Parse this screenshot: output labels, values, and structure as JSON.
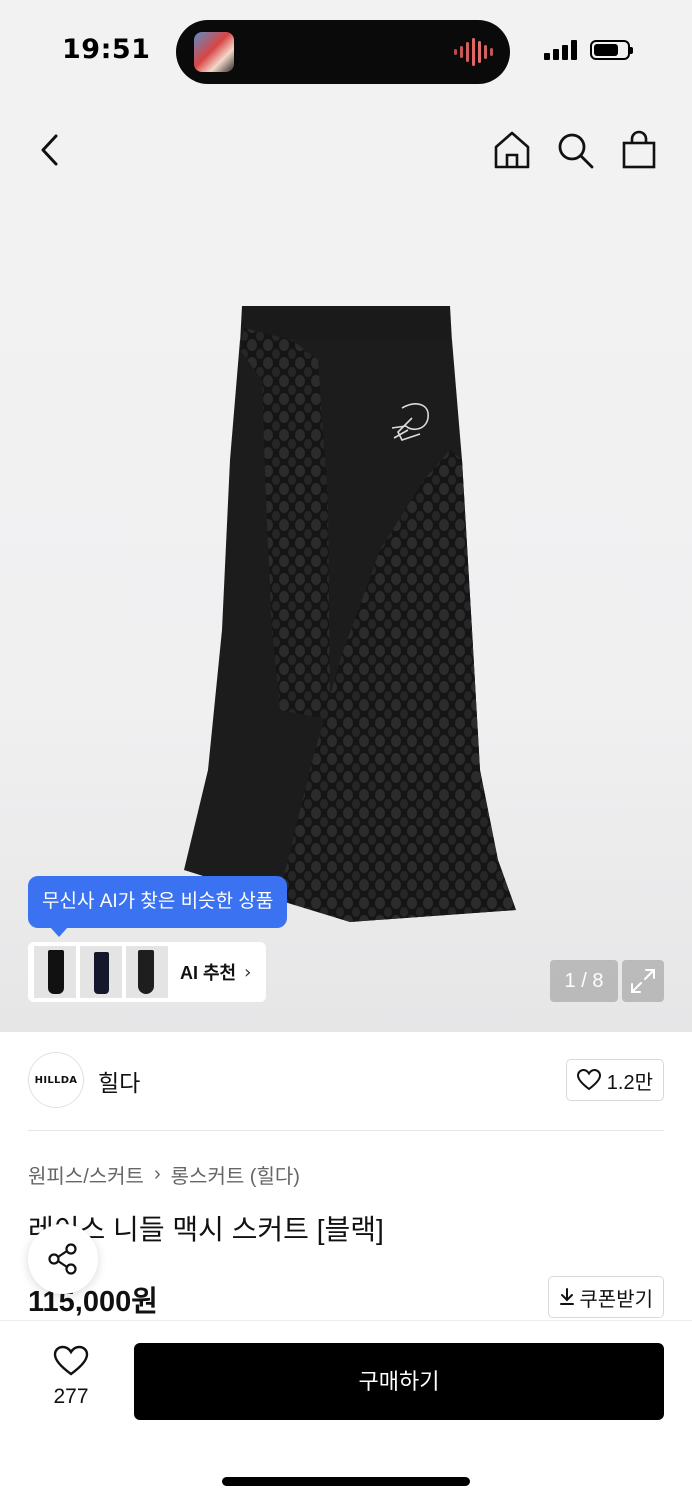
{
  "status": {
    "time": "19:51"
  },
  "header": {
    "back_icon": "chevron-left-icon",
    "home_icon": "home-icon",
    "search_icon": "search-icon",
    "cart_icon": "shopping-bag-icon"
  },
  "gallery": {
    "ai_tooltip": "무신사 AI가 찾은 비슷한 상품",
    "ai_label": "AI 추천",
    "counter": "1 / 8",
    "accent_color": "#3a72f2"
  },
  "brand": {
    "logo_text": "HILLDA",
    "name": "힐다",
    "likes": "1.2만"
  },
  "breadcrumb": [
    "원피스/스커트",
    "롱스커트 (힐다)"
  ],
  "product": {
    "title": "레이스 니들 맥시 스커트 [블랙]",
    "price": "115,000원",
    "coupon_label": "쿠폰받기"
  },
  "bottom": {
    "wish_count": "277",
    "buy_label": "구매하기"
  }
}
